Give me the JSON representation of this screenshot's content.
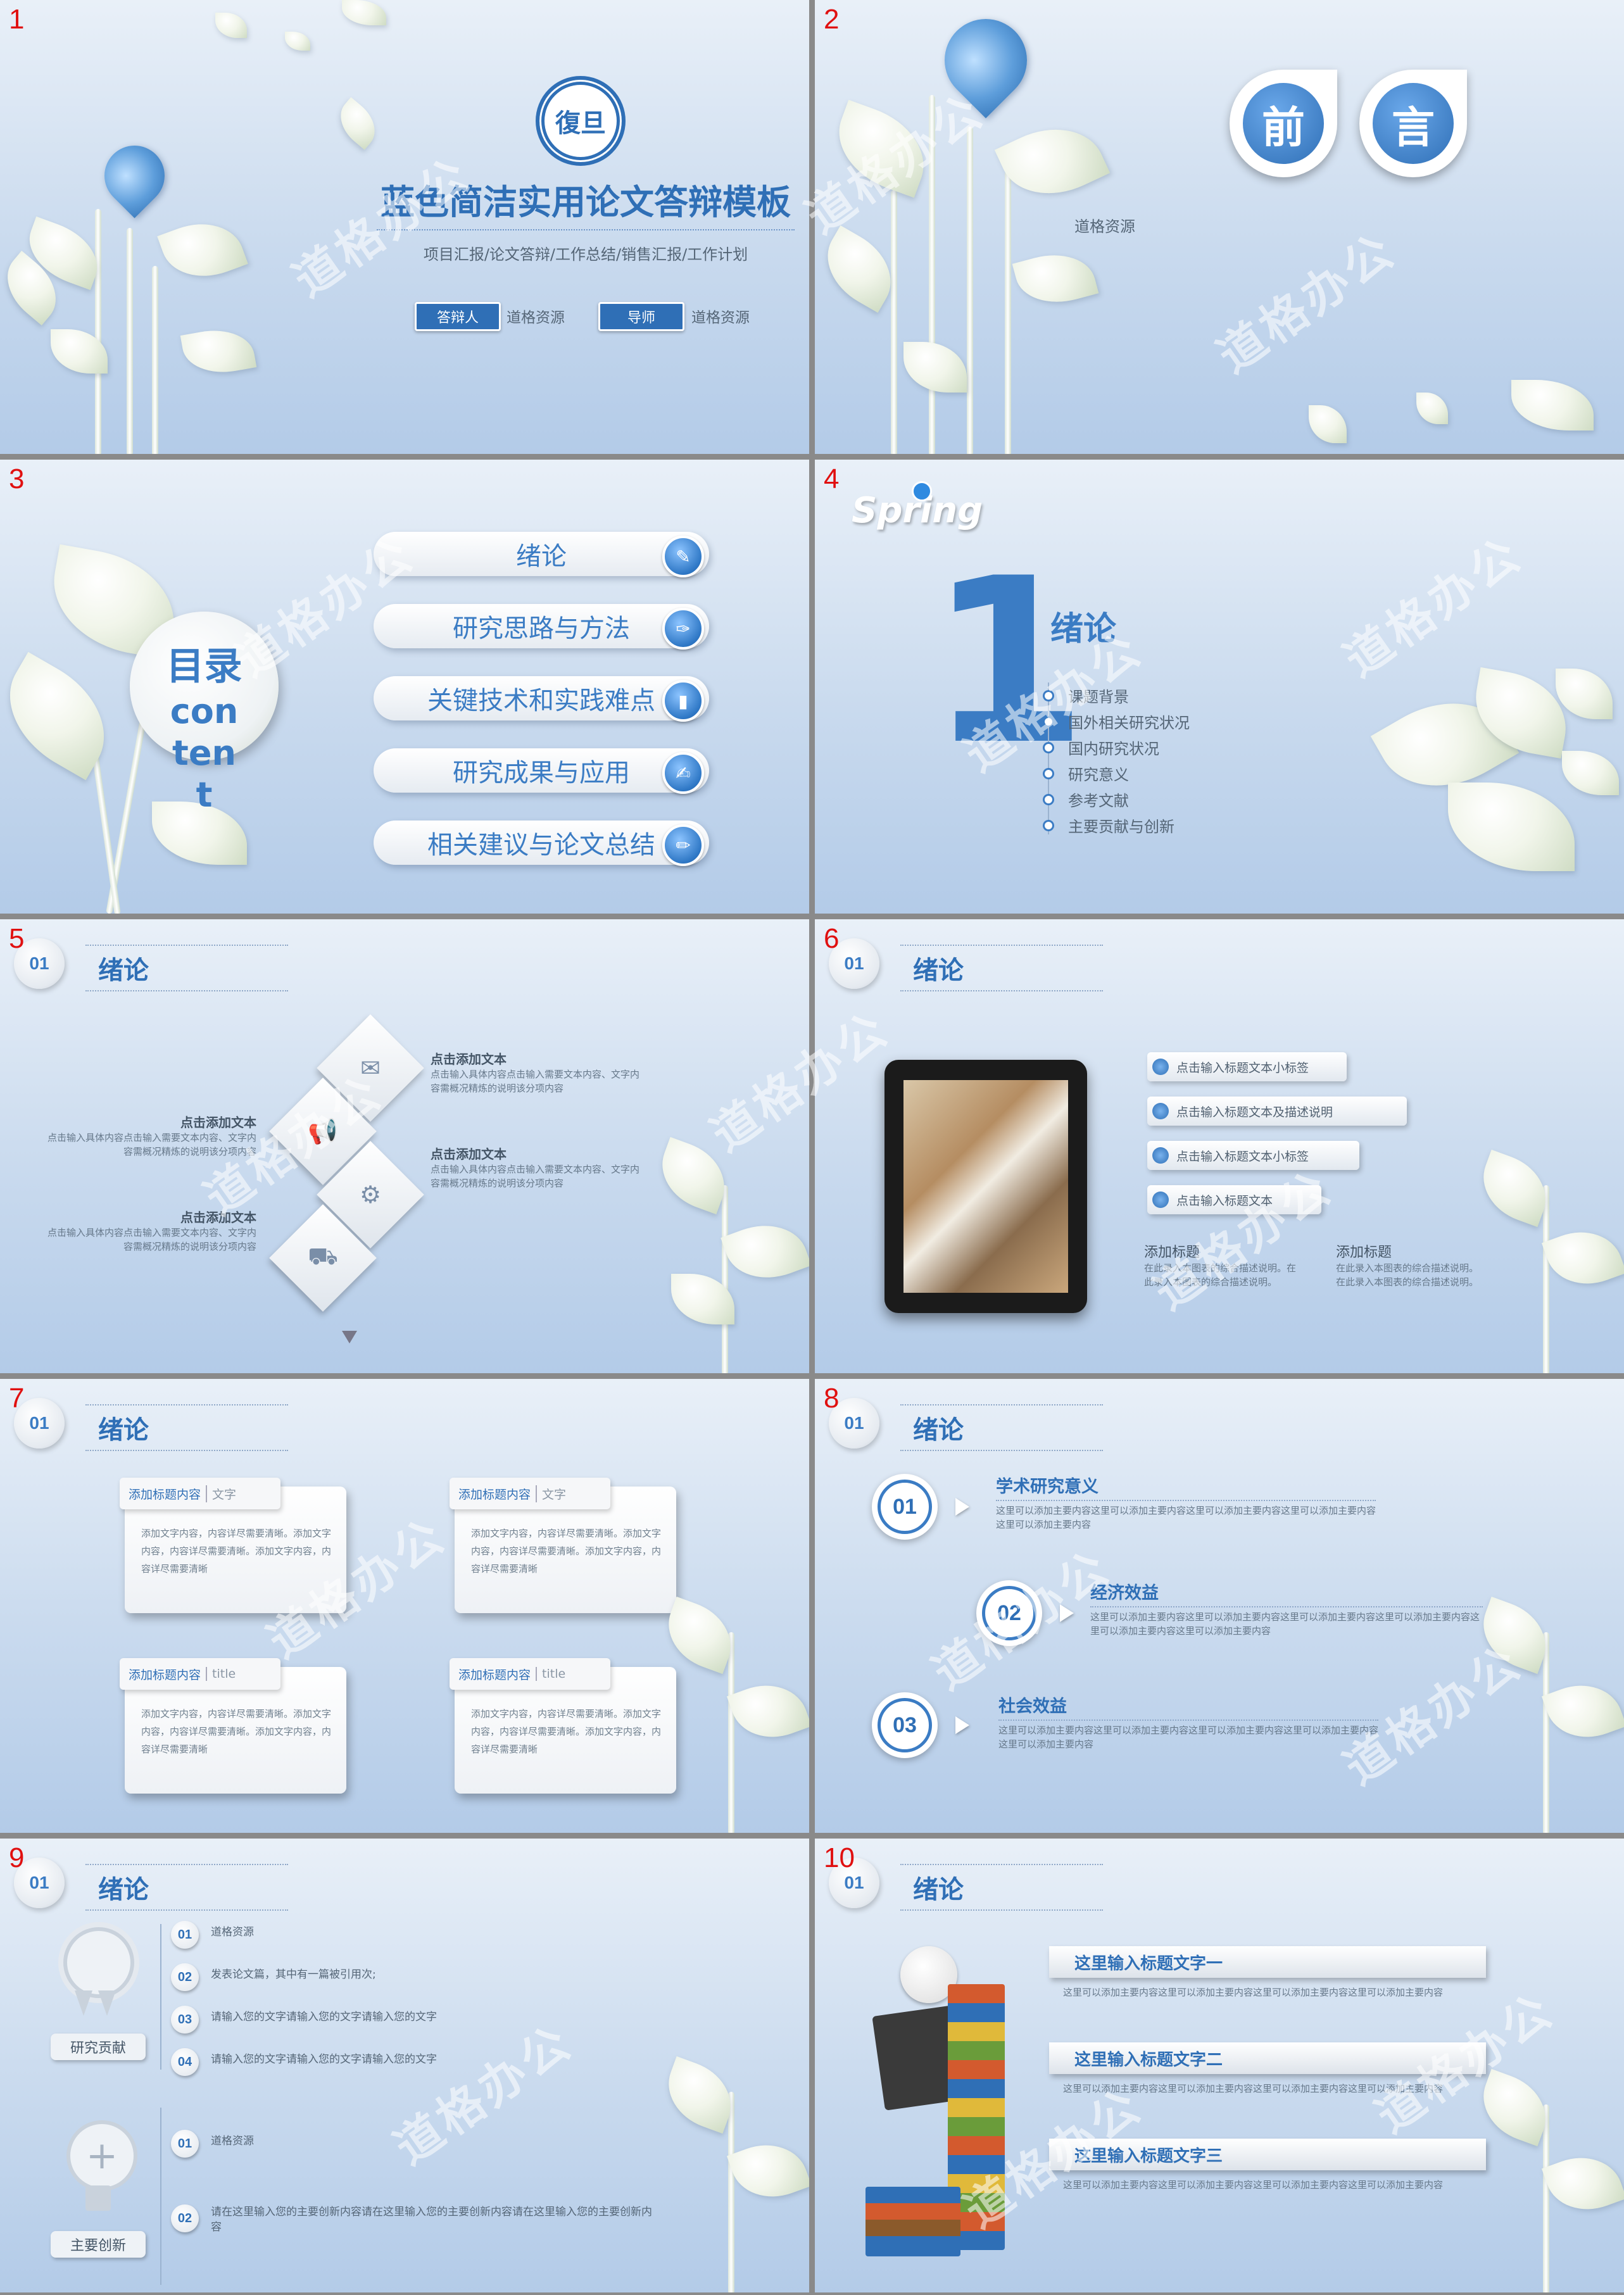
{
  "watermark": "道格办公",
  "slides": {
    "s1": {
      "num": "1",
      "logo_text": "復旦",
      "title": "蓝色简洁实用论文答辩模板",
      "subtitle": "项目汇报/论文答辩/工作总结/销售汇报/工作计划",
      "btn1": "答辩人",
      "val1": "道格资源",
      "btn2": "导师",
      "val2": "道格资源"
    },
    "s2": {
      "num": "2",
      "char1": "前",
      "char2": "言",
      "text": "道格资源"
    },
    "s3": {
      "num": "3",
      "mulu": "目录",
      "content": "content",
      "items": [
        "绪论",
        "研究思路与方法",
        "关键技术和实践难点",
        "研究成果与应用",
        "相关建议与论文总结"
      ]
    },
    "s4": {
      "num": "4",
      "spring": "Spring",
      "big": "1",
      "title": "绪论",
      "items": [
        "课题背景",
        "国外相关研究状况",
        "国内研究状况",
        "研究意义",
        "参考文献",
        "主要贡献与创新"
      ]
    },
    "s5": {
      "num": "5",
      "circle": "01",
      "title": "绪论",
      "blocks": [
        {
          "h": "点击添加文本",
          "t": "点击输入具体内容点击输入需要文本内容、文字内容需概况精炼的说明该分项内容"
        },
        {
          "h": "点击添加文本",
          "t": "点击输入具体内容点击输入需要文本内容、文字内容需概况精炼的说明该分项内容"
        },
        {
          "h": "点击添加文本",
          "t": "点击输入具体内容点击输入需要文本内容、文字内容需概况精炼的说明该分项内容"
        },
        {
          "h": "点击添加文本",
          "t": "点击输入具体内容点击输入需要文本内容、文字内容需概况精炼的说明该分项内容"
        }
      ]
    },
    "s6": {
      "num": "6",
      "circle": "01",
      "title": "绪论",
      "bars": [
        "点击输入标题文本小标签",
        "点击输入标题文本及描述说明",
        "点击输入标题文本小标签",
        "点击输入标题文本"
      ],
      "c1h": "添加标题",
      "c1t": "在此录入本图表的综合描述说明。在此录入本图表的综合描述说明。",
      "c2h": "添加标题",
      "c2t": "在此录入本图表的综合描述说明。在此录入本图表的综合描述说明。"
    },
    "s7": {
      "num": "7",
      "circle": "01",
      "title": "绪论",
      "cards": [
        {
          "h": "添加标题内容",
          "sub": "文字",
          "t": "添加文字内容，内容详尽需要清晰。添加文字内容，内容详尽需要清晰。添加文字内容，内容详尽需要清晰"
        },
        {
          "h": "添加标题内容",
          "sub": "文字",
          "t": "添加文字内容，内容详尽需要清晰。添加文字内容，内容详尽需要清晰。添加文字内容，内容详尽需要清晰"
        },
        {
          "h": "添加标题内容",
          "sub": "title",
          "t": "添加文字内容，内容详尽需要清晰。添加文字内容，内容详尽需要清晰。添加文字内容，内容详尽需要清晰"
        },
        {
          "h": "添加标题内容",
          "sub": "title",
          "t": "添加文字内容，内容详尽需要清晰。添加文字内容，内容详尽需要清晰。添加文字内容，内容详尽需要清晰"
        }
      ]
    },
    "s8": {
      "num": "8",
      "circle": "01",
      "title": "绪论",
      "items": [
        {
          "n": "01",
          "h": "学术研究意义",
          "t": "这里可以添加主要内容这里可以添加主要内容这里可以添加主要内容这里可以添加主要内容这里可以添加主要内容"
        },
        {
          "n": "02",
          "h": "经济效益",
          "t": "这里可以添加主要内容这里可以添加主要内容这里可以添加主要内容这里可以添加主要内容这里可以添加主要内容这里可以添加主要内容"
        },
        {
          "n": "03",
          "h": "社会效益",
          "t": "这里可以添加主要内容这里可以添加主要内容这里可以添加主要内容这里可以添加主要内容这里可以添加主要内容"
        }
      ]
    },
    "s9": {
      "num": "9",
      "circle": "01",
      "title": "绪论",
      "label1": "研究贡献",
      "label2": "主要创新",
      "list1": [
        {
          "n": "01",
          "t": "道格资源"
        },
        {
          "n": "02",
          "t": "发表论文篇，其中有一篇被引用次;"
        },
        {
          "n": "03",
          "t": "请输入您的文字请输入您的文字请输入您的文字"
        },
        {
          "n": "04",
          "t": "请输入您的文字请输入您的文字请输入您的文字"
        }
      ],
      "list2": [
        {
          "n": "01",
          "t": "道格资源"
        },
        {
          "n": "02",
          "t": "请在这里输入您的主要创新内容请在这里输入您的主要创新内容请在这里输入您的主要创新内容"
        }
      ]
    },
    "s10": {
      "num": "10",
      "circle": "01",
      "title": "绪论",
      "items": [
        {
          "h": "这里输入标题文字一",
          "t": "这里可以添加主要内容这里可以添加主要内容这里可以添加主要内容这里可以添加主要内容"
        },
        {
          "h": "这里输入标题文字二",
          "t": "这里可以添加主要内容这里可以添加主要内容这里可以添加主要内容这里可以添加主要内容"
        },
        {
          "h": "这里输入标题文字三",
          "t": "这里可以添加主要内容这里可以添加主要内容这里可以添加主要内容这里可以添加主要内容"
        }
      ]
    }
  }
}
